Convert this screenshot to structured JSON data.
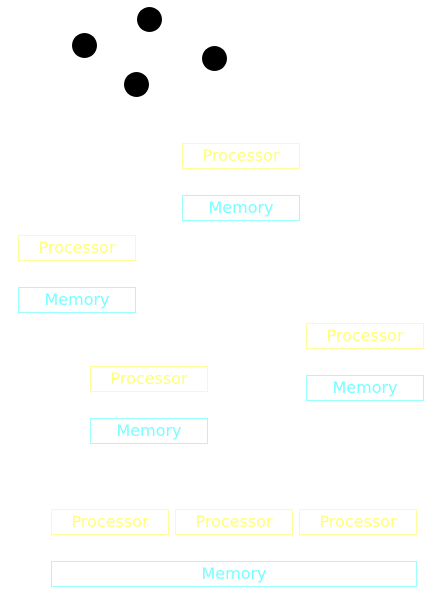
{
  "labels": {
    "processor": "Processor",
    "memory": "Memory"
  },
  "colors": {
    "processor": "#ffff77",
    "memory": "#77ffff",
    "node": "#000000",
    "background": "#ffffff"
  },
  "nodes": {
    "dots": [
      "node-1",
      "node-2",
      "node-3",
      "node-4"
    ]
  },
  "groups": [
    {
      "name": "group-a",
      "processors": 1,
      "memories": 1
    },
    {
      "name": "group-b",
      "processors": 1,
      "memories": 1
    },
    {
      "name": "group-c",
      "processors": 1,
      "memories": 1
    },
    {
      "name": "group-d",
      "processors": 1,
      "memories": 1
    },
    {
      "name": "shared-memory-group",
      "processors": 3,
      "memories": 1
    }
  ]
}
